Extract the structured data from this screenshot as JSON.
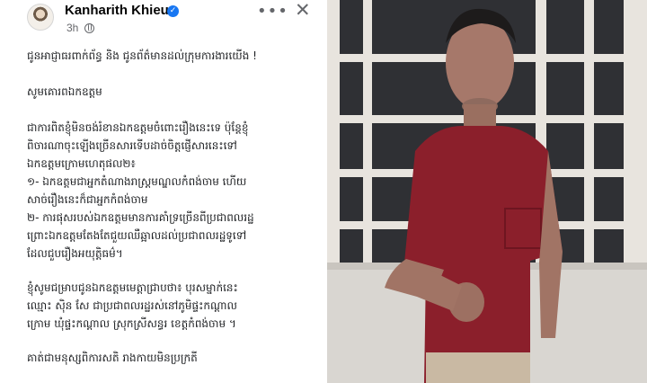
{
  "post": {
    "author": "Kanharith Khieu",
    "time": "3h",
    "more_label": "•••",
    "close_label": "✕",
    "verified_mark": "✓",
    "paragraphs": [
      [
        "ជូនអាជ្ញាធរពាក់ព័ន្ធ និង ជូនព័ត៌មានដល់ក្រុមការងារយើង !"
      ],
      [
        "សូមគោរពឯកឧត្តម"
      ],
      [
        "ជាការពិតខ្ញុំមិនចង់រំខានឯកឧត្តមចំពោះរឿងនេះទេ ប៉ុន្តែខ្ញុំ",
        "ពិចារណាចុះឡើងច្រើនសារទើបដាច់ចិត្តផ្ញើសារនេះទៅ",
        "ឯកឧត្តមក្រោមហេតុផល២៖",
        "១- ឯកឧត្តមជាអ្នកតំណាងរាស្ត្រមណ្ឌលកំពង់ចាម ហើយ",
        "សាច់រឿងនេះក៏ជាអ្នកកំពង់ចាម",
        "២- ការផុសរបស់ឯកឧត្តមមានការគាំទ្រច្រើនពីប្រជាពលរដ្ឋ",
        "ព្រោះឯកឧត្តមតែងតែជួយឈឺឆ្អាលដល់ប្រជាពលរដ្ឋទូទៅ",
        "ដែលជួបរឿងអយុត្តិធម៌។"
      ],
      [
        "ខ្ញុំសូមជម្រាបជូនឯកឧត្តមមេត្តាជ្រាបថា៖ បុរសម្នាក់នេះ",
        "ឈ្មោះ  ស៊ិន សែ ជាប្រជាពលរដ្ឋរស់នៅភូមិផ្ទះកណ្ដាល",
        "ក្រោម ឃុំផ្ទះកណ្ដាល ស្រុកស្រីសន្ធរ ខេត្តកំពង់ចាម ។"
      ]
    ],
    "cut_line": "គាត់ជាមនុស្សពិការសតិ រាងកាយមិនប្រក្រតី"
  },
  "colors": {
    "name": "#050505",
    "meta": "#65676b",
    "verified": "#1877f2",
    "text": "#1c1e21",
    "shirt": "#8b1f2b"
  },
  "icons": [
    "avatar",
    "verified-badge-icon",
    "globe-icon",
    "more-options-icon",
    "close-icon"
  ]
}
